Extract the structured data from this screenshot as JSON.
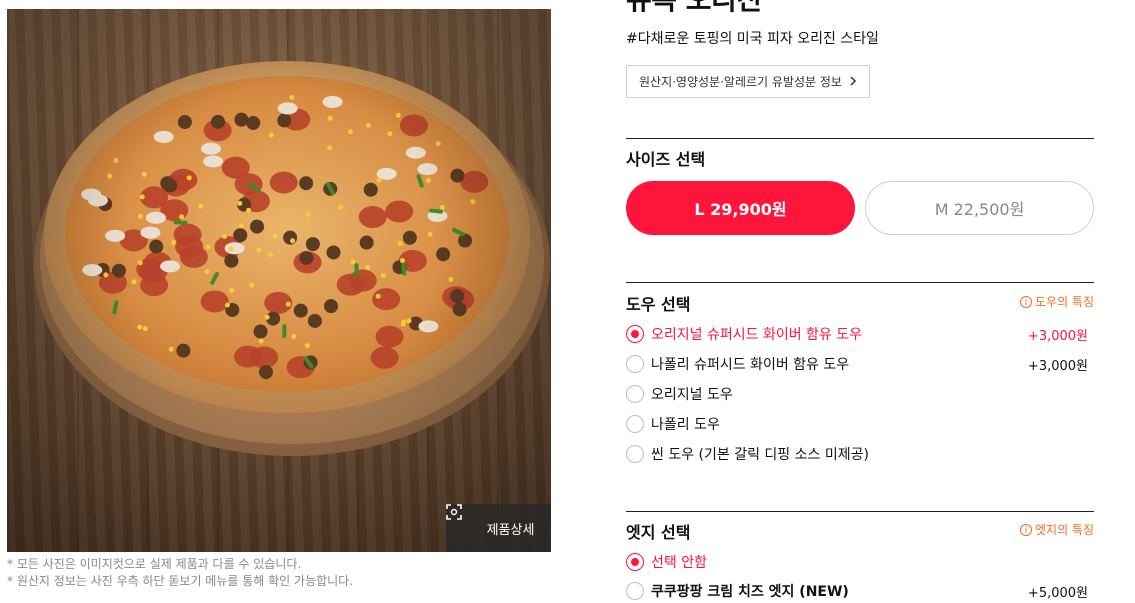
{
  "product": {
    "title": "뉴욕 오리진",
    "subtitle": "#다채로운 토핑의 미국 피자 오리진 스타일",
    "info_button": "원산지·영양성분·알레르기 유발성분 정보",
    "detail_button": "제품상세",
    "notes": [
      "* 모든 사진은 이미지컷으로 실제 제품과 다를 수 있습니다.",
      "* 원산지 정보는 사진 우측 하단 돋보기 메뉴를 통해 확인 가능합니다."
    ]
  },
  "size": {
    "title": "사이즈 선택",
    "options": [
      {
        "label": "L 29,900원",
        "selected": true
      },
      {
        "label": "M 22,500원",
        "selected": false
      }
    ]
  },
  "dough": {
    "title": "도우 선택",
    "link": "도우의 특징",
    "options": [
      {
        "label": "오리지널 슈퍼시드 화이버 함유 도우",
        "price": "+3,000원",
        "selected": true
      },
      {
        "label": "나폴리 슈퍼시드 화이버 함유 도우",
        "price": "+3,000원",
        "selected": false
      },
      {
        "label": "오리지널 도우",
        "price": "",
        "selected": false
      },
      {
        "label": "나폴리 도우",
        "price": "",
        "selected": false
      },
      {
        "label": "씬 도우 (기본 갈릭 디핑 소스 미제공)",
        "price": "",
        "selected": false
      }
    ]
  },
  "edge": {
    "title": "엣지 선택",
    "link": "엣지의 특징",
    "options": [
      {
        "label": "선택 안함",
        "price": "",
        "selected": true
      },
      {
        "label": "쿠쿠팡팡 크림 치즈 엣지 (NEW)",
        "price": "+5,000원",
        "selected": false
      }
    ]
  },
  "colors": {
    "accent": "#ff143c",
    "link": "#ff6a1a"
  }
}
